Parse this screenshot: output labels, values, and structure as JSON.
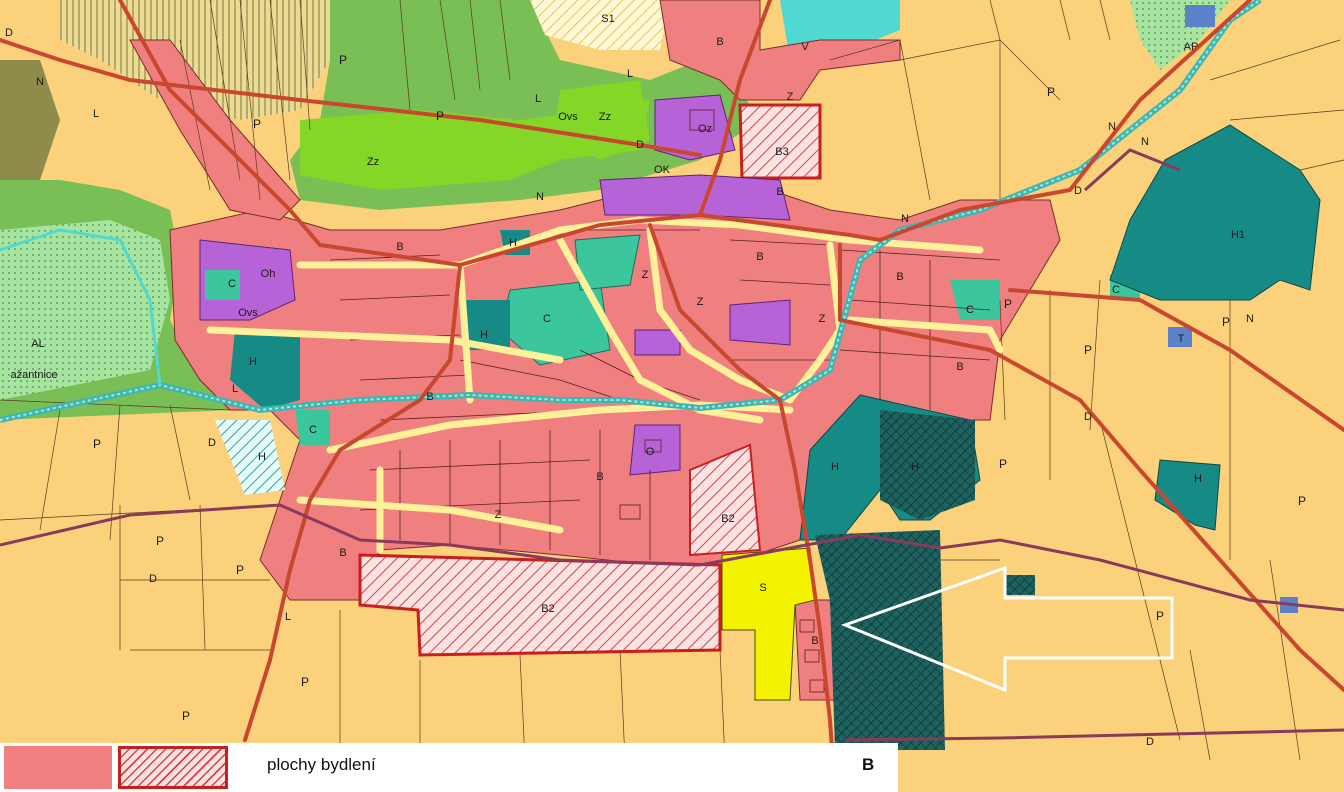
{
  "colors": {
    "agricultural": "#fcd17b",
    "residential": "#f08080",
    "residential_border": "#c91e1e",
    "road": "#c8472e",
    "street": "#fff199",
    "forest_green": "#79bf55",
    "park_green": "#84d627",
    "civic": "#b763d8",
    "commerce": "#3cc69d",
    "industry": "#168b86",
    "leisure": "#f3f300",
    "orchard": "#e6d57c",
    "bright_green": "#a8e4a1",
    "water": "#4fd9d2",
    "nature": "#8e8b4b",
    "technical": "#5b82c8"
  },
  "map_labels": {
    "p": "P",
    "b": "B",
    "n": "N",
    "l": "L",
    "d": "D",
    "z": "Z",
    "c": "C",
    "h": "H",
    "h1": "H1",
    "s": "S",
    "s1": "S1",
    "b2": "B2",
    "b3": "B3",
    "zz": "Zz",
    "oh": "Oh",
    "oz": "Oz",
    "ok": "OK",
    "o": "O",
    "ovs": "Ovs",
    "al": "AL",
    "ap": "AP",
    "v": "V",
    "t": "T",
    "place": "ažantnice"
  },
  "legend": {
    "label": "plochy bydlení",
    "code": "B"
  }
}
